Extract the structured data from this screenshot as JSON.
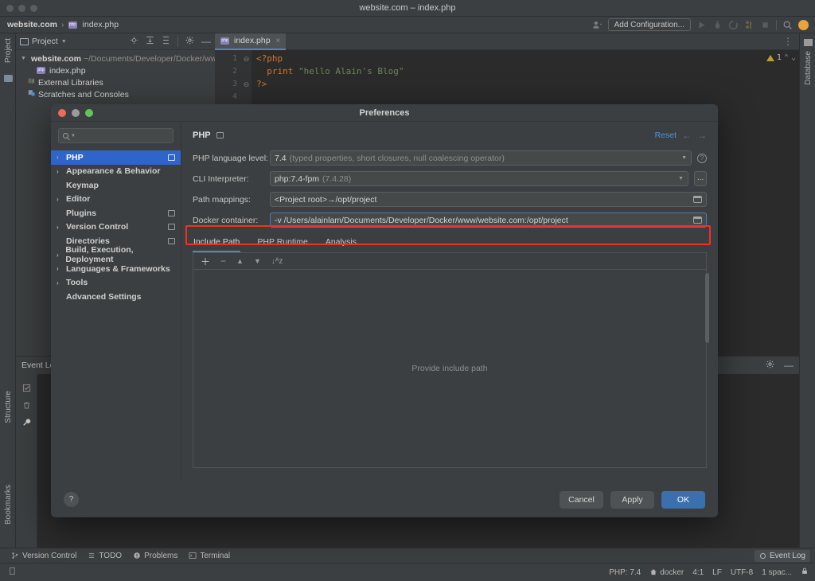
{
  "window": {
    "title": "website.com – index.php"
  },
  "toolbar": {
    "breadcrumb_project": "website.com",
    "breadcrumb_sep": "›",
    "breadcrumb_file": "index.php",
    "add_configuration": "Add Configuration...",
    "icons": [
      "user-profile-icon",
      "run-icon",
      "debug-icon",
      "run-coverage-icon",
      "profiler-icon",
      "stop-icon",
      "search-icon",
      "account-avatar"
    ]
  },
  "project_panel": {
    "title": "Project",
    "header_icons": [
      "locate-icon",
      "expand-all-icon",
      "collapse-all-icon",
      "settings-gear-icon",
      "hide-icon"
    ],
    "tree": [
      {
        "label": "website.com",
        "path": "~/Documents/Developer/Docker/ww",
        "type": "folder",
        "expanded": true
      },
      {
        "label": "index.php",
        "path": "",
        "type": "php-file",
        "expanded": false
      },
      {
        "label": "External Libraries",
        "path": "",
        "type": "libraries",
        "expanded": false
      },
      {
        "label": "Scratches and Consoles",
        "path": "",
        "type": "scratches",
        "expanded": false
      }
    ]
  },
  "editor": {
    "tab_label": "index.php",
    "warning_count": "1",
    "lines": [
      {
        "num": "1",
        "fold": "⊖",
        "html": "<?php"
      },
      {
        "num": "2",
        "fold": "",
        "html": "print \"hello Alain's Blog\""
      },
      {
        "num": "3",
        "fold": "⊖",
        "html": "?>"
      },
      {
        "num": "4",
        "fold": "",
        "html": ""
      }
    ],
    "code_text": {
      "l1": "<?php",
      "l2_kw": "print",
      "l2_str": "\"hello Alain's Blog\"",
      "l3": "?>"
    }
  },
  "event_panel": {
    "title": "Event Lo"
  },
  "vertical_strips": {
    "left_top": "Project",
    "left_mid": "Structure",
    "left_bottom": "Bookmarks",
    "right": "Database"
  },
  "navbar": {
    "items": [
      {
        "label": "Version Control",
        "icon": "branch-icon"
      },
      {
        "label": "TODO",
        "icon": "list-icon"
      },
      {
        "label": "Problems",
        "icon": "error-icon"
      },
      {
        "label": "Terminal",
        "icon": "terminal-icon"
      }
    ],
    "event_log": "Event Log"
  },
  "statusbar": {
    "items": [
      "PHP: 7.4",
      "docker",
      "4:1",
      "LF",
      "UTF-8",
      "1 spac..."
    ],
    "lock_icon": "lock-icon"
  },
  "preferences": {
    "title": "Preferences",
    "search_placeholder": "",
    "sidebar": [
      {
        "label": "PHP",
        "arrow": true,
        "badge": true,
        "selected": true
      },
      {
        "label": "Appearance & Behavior",
        "arrow": true,
        "badge": false,
        "selected": false
      },
      {
        "label": "Keymap",
        "arrow": false,
        "badge": false,
        "selected": false
      },
      {
        "label": "Editor",
        "arrow": true,
        "badge": false,
        "selected": false
      },
      {
        "label": "Plugins",
        "arrow": false,
        "badge": true,
        "selected": false
      },
      {
        "label": "Version Control",
        "arrow": true,
        "badge": true,
        "selected": false
      },
      {
        "label": "Directories",
        "arrow": false,
        "badge": true,
        "selected": false
      },
      {
        "label": "Build, Execution, Deployment",
        "arrow": true,
        "badge": false,
        "selected": false
      },
      {
        "label": "Languages & Frameworks",
        "arrow": true,
        "badge": false,
        "selected": false
      },
      {
        "label": "Tools",
        "arrow": true,
        "badge": false,
        "selected": false
      },
      {
        "label": "Advanced Settings",
        "arrow": false,
        "badge": false,
        "selected": false
      }
    ],
    "page_title": "PHP",
    "reset_label": "Reset",
    "fields": {
      "lang_level_label": "PHP language level:",
      "lang_level_value": "7.4",
      "lang_level_hint": "(typed properties, short closures, null coalescing operator)",
      "cli_label": "CLI Interpreter:",
      "cli_value": "php:7.4-fpm",
      "cli_hint": "(7.4.28)",
      "cli_more": "...",
      "path_map_label": "Path mappings:",
      "path_map_value": "<Project root>→/opt/project",
      "docker_label": "Docker container:",
      "docker_value": "-v /Users/alainlam/Documents/Developer/Docker/www/website.com:/opt/project"
    },
    "tabs": [
      {
        "label": "Include Path",
        "active": true
      },
      {
        "label": "PHP Runtime",
        "active": false
      },
      {
        "label": "Analysis",
        "active": false
      }
    ],
    "list_toolbar_icons": [
      "add-icon",
      "remove-icon",
      "move-up-icon",
      "move-down-icon",
      "sort-icon"
    ],
    "empty_message": "Provide include path",
    "help_label": "?",
    "buttons": {
      "cancel": "Cancel",
      "apply": "Apply",
      "ok": "OK"
    }
  },
  "colors": {
    "accent_blue": "#2f65ca",
    "link_blue": "#4b93e0",
    "highlight_red": "#f3301f",
    "ok_button": "#3b6fad",
    "panel_bg": "#3c3f41",
    "editor_bg": "#2b2b2b"
  }
}
